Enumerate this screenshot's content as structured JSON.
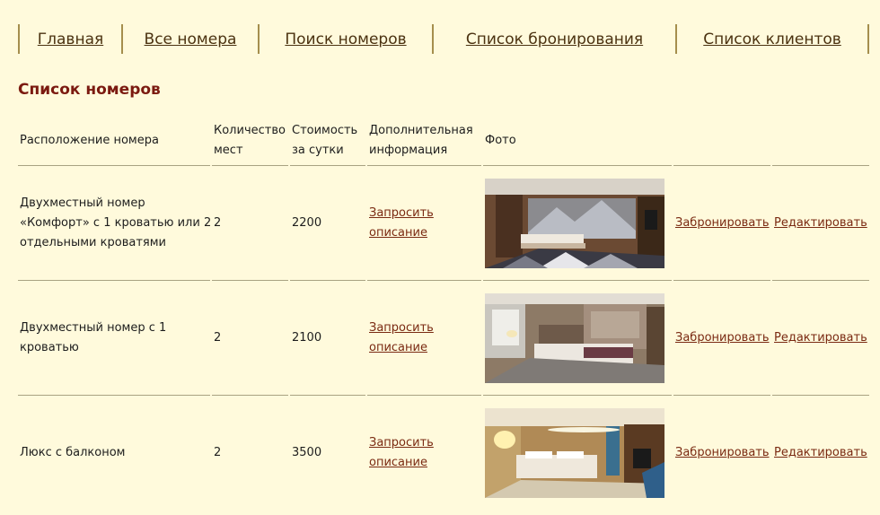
{
  "nav": {
    "items": [
      {
        "label": "Главная"
      },
      {
        "label": "Все номера"
      },
      {
        "label": "Поиск номеров"
      },
      {
        "label": "Список бронирования"
      },
      {
        "label": "Список клиентов"
      }
    ]
  },
  "page": {
    "title": "Список номеров"
  },
  "table": {
    "headers": {
      "location": "Расположение номера",
      "seats_line1": "Количество",
      "seats_line2": "мест",
      "price_line1": "Стоимость",
      "price_line2": "за сутки",
      "info_line1": "Дополнительная",
      "info_line2": "информация",
      "photo": "Фото"
    },
    "rows": [
      {
        "location_lines": [
          "Двухместный номер",
          "«Комфорт» с 1 кроватью или 2",
          "отдельными кроватями"
        ],
        "seats": "2",
        "price": "2200",
        "info_line1": "Запросить",
        "info_line2": "описание",
        "photo_icon": "room-photo-comfort",
        "book": "Забронировать",
        "edit": "Редактировать"
      },
      {
        "location_lines": [
          "Двухместный номер с 1",
          "кроватью"
        ],
        "seats": "2",
        "price": "2100",
        "info_line1": "Запросить",
        "info_line2": "описание",
        "photo_icon": "room-photo-double",
        "book": "Забронировать",
        "edit": "Редактировать"
      },
      {
        "location_lines": [
          "Люкс с балконом"
        ],
        "seats": "2",
        "price": "3500",
        "info_line1": "Запросить",
        "info_line2": "описание",
        "photo_icon": "room-photo-lux",
        "book": "Забронировать",
        "edit": "Редактировать"
      }
    ]
  },
  "colors": {
    "background": "#fffadc",
    "title": "#7b1a10",
    "nav_link": "#4b3210",
    "link": "#7a2a12",
    "separator": "#a58e4d"
  }
}
